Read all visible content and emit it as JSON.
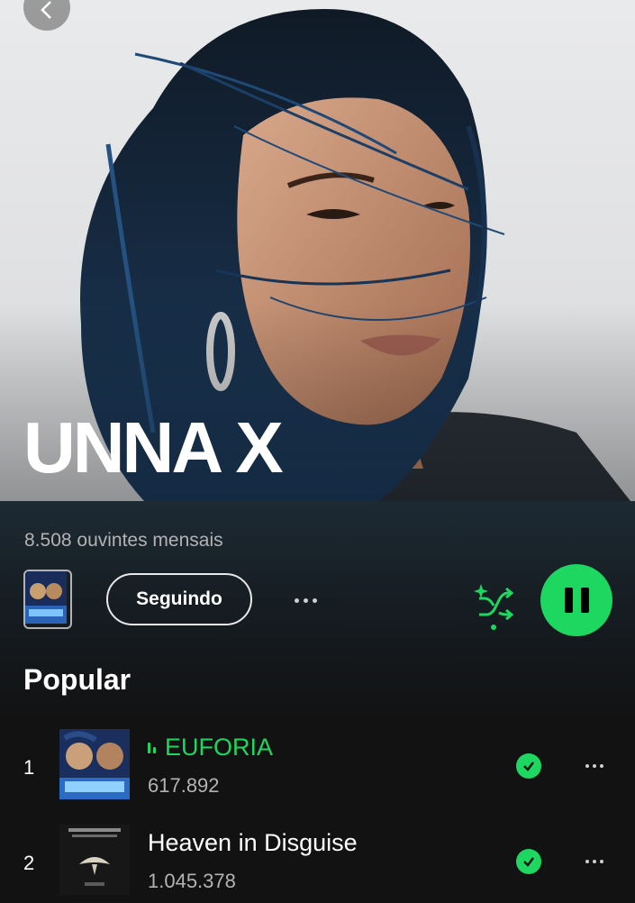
{
  "artist": {
    "name": "UNNA X",
    "monthly_listeners": "8.508 ouvintes mensais"
  },
  "actions": {
    "follow_label": "Seguindo"
  },
  "section": {
    "title": "Popular"
  },
  "tracks": [
    {
      "number": "1",
      "title": "EUFORIA",
      "plays": "617.892",
      "playing": true,
      "saved": true
    },
    {
      "number": "2",
      "title": "Heaven in Disguise",
      "plays": "1.045.378",
      "playing": false,
      "saved": true
    }
  ],
  "colors": {
    "accent": "#1ed760",
    "background": "#121212",
    "secondary_text": "#b3b3b3"
  },
  "icons": {
    "back": "chevron-left-icon",
    "more": "more-horizontal-icon",
    "smart_shuffle": "smart-shuffle-icon",
    "pause": "pause-icon",
    "saved": "check-circle-icon"
  }
}
